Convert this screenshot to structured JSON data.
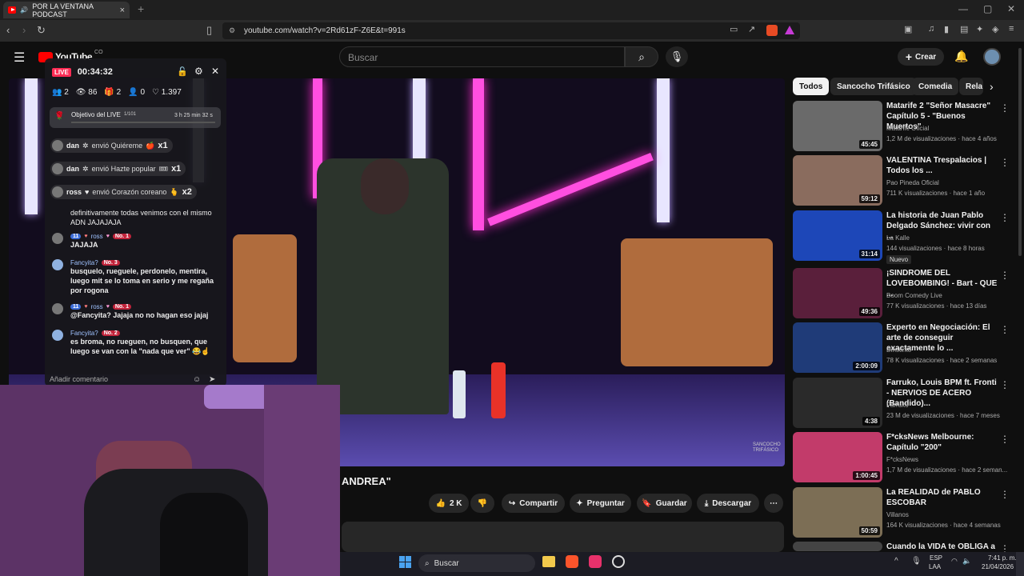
{
  "browser": {
    "tab_title": "POR LA VENTANA PODCAST",
    "tab_close": "×",
    "new_tab": "+",
    "url": "youtube.com/watch?v=2Rd61zF-Z6E&t=991s"
  },
  "youtube": {
    "logo": "YouTube",
    "logo_country": "CO",
    "search_placeholder": "Buscar",
    "create_label": "Crear"
  },
  "live": {
    "badge": "LIVE",
    "timer": "00:34:32",
    "stats": {
      "guests": "2",
      "viewers": "86",
      "gifts": "2",
      "followers": "0",
      "likes": "1.397"
    },
    "goal_label": "Objetivo del LIVE",
    "goal_count": "1/101",
    "goal_time": "3 h 25 min 32 s",
    "gifts": [
      {
        "user": "dan",
        "text": "envió Quiéreme",
        "count": "x1"
      },
      {
        "user": "dan",
        "text": "envió Hazte popular",
        "count": "x1"
      },
      {
        "user": "ross",
        "text": "envió Corazón coreano",
        "count": "x2"
      }
    ],
    "messages": [
      {
        "text": "definitivamente todas venimos con el mismo ADN JAJAJAJA"
      },
      {
        "level": "11",
        "user": "ross",
        "rank": "No. 1",
        "text": "JAJAJA"
      },
      {
        "user": "Fancyita?",
        "rank": "No. 3",
        "text": "busquelo, rueguele, perdonelo, mentira, luego mit se lo toma en serio y me regaña por rogona"
      },
      {
        "level": "11",
        "user": "ross",
        "rank": "No. 1",
        "text": "@Fancyita? Jajaja no no hagan eso jajaj"
      },
      {
        "user": "Fancyita?",
        "rank": "No. 2",
        "text": "es broma, no rueguen, no busquen, que luego se van con la \"nada que ver\" 😂☝"
      }
    ],
    "comment_placeholder": "Añadir comentario"
  },
  "video": {
    "title": "ANDREA\"",
    "watermark": "SANCOCHO TRIFÁSICO",
    "likes": "2 K",
    "share": "Compartir",
    "ask": "Preguntar",
    "save": "Guardar",
    "download": "Descargar"
  },
  "chips": [
    "Todos",
    "Sancocho Trifásico",
    "Comedia",
    "Rela"
  ],
  "recommendations": [
    {
      "title": "Matarife 2 \"Señor Masacre\" Capítulo 5 - \"Buenos Muertos\"",
      "channel": "Matarife Oficial",
      "views": "1,2 M de visualizaciones · hace 4 años",
      "duration": "45:45",
      "color": "#6a6a6a"
    },
    {
      "title": "VALENTINA Trespalacios | Todos los ...",
      "channel": "Pao Pineda Oficial",
      "views": "711 K visualizaciones · hace 1 año",
      "duration": "59:12",
      "color": "#8a6c5e"
    },
    {
      "title": "La historia de Juan Pablo Delgado Sánchez: vivir con ...",
      "channel": "La Kalle",
      "views": "144 visualizaciones · hace 8 horas",
      "duration": "31:14",
      "badge": "Nuevo",
      "color": "#1d47b8"
    },
    {
      "title": "¡SINDROME DEL LOVEBOMBING! - Bart - QUE ...",
      "channel": "Boom Comedy Live",
      "views": "77 K visualizaciones · hace 13 días",
      "duration": "49:36",
      "color": "#5a1f3b"
    },
    {
      "title": "Experto en Negociación: El arte de conseguir exactamente lo ...",
      "channel": "Dinstinto",
      "views": "78 K visualizaciones · hace 2 semanas",
      "duration": "2:00:09",
      "color": "#1f3b78"
    },
    {
      "title": "Farruko, Louis BPM ft. Fronti - NERVIOS DE ACERO (Bandido)...",
      "channel": "Farruko",
      "views": "23 M de visualizaciones · hace 7 meses",
      "duration": "4:38",
      "color": "#2a2a2a"
    },
    {
      "title": "F*cksNews Melbourne: Capítulo \"200\"",
      "channel": "F*cksNews",
      "views": "1,7 M de visualizaciones · hace 2 seman...",
      "duration": "1:00:45",
      "color": "#c23b6a"
    },
    {
      "title": "La REALIDAD de PABLO ESCOBAR",
      "channel": "Villanos",
      "views": "164 K visualizaciones · hace 4 semanas",
      "duration": "50:59",
      "color": "#7c6e55"
    },
    {
      "title": "Cuando la VIDA te OBLIGA a",
      "channel": "",
      "views": "",
      "duration": "",
      "color": "#444"
    }
  ],
  "taskbar": {
    "search": "Buscar",
    "lang1": "ESP",
    "lang2": "LAA",
    "time": "7:41 p. m.",
    "date": "21/04/2026"
  }
}
